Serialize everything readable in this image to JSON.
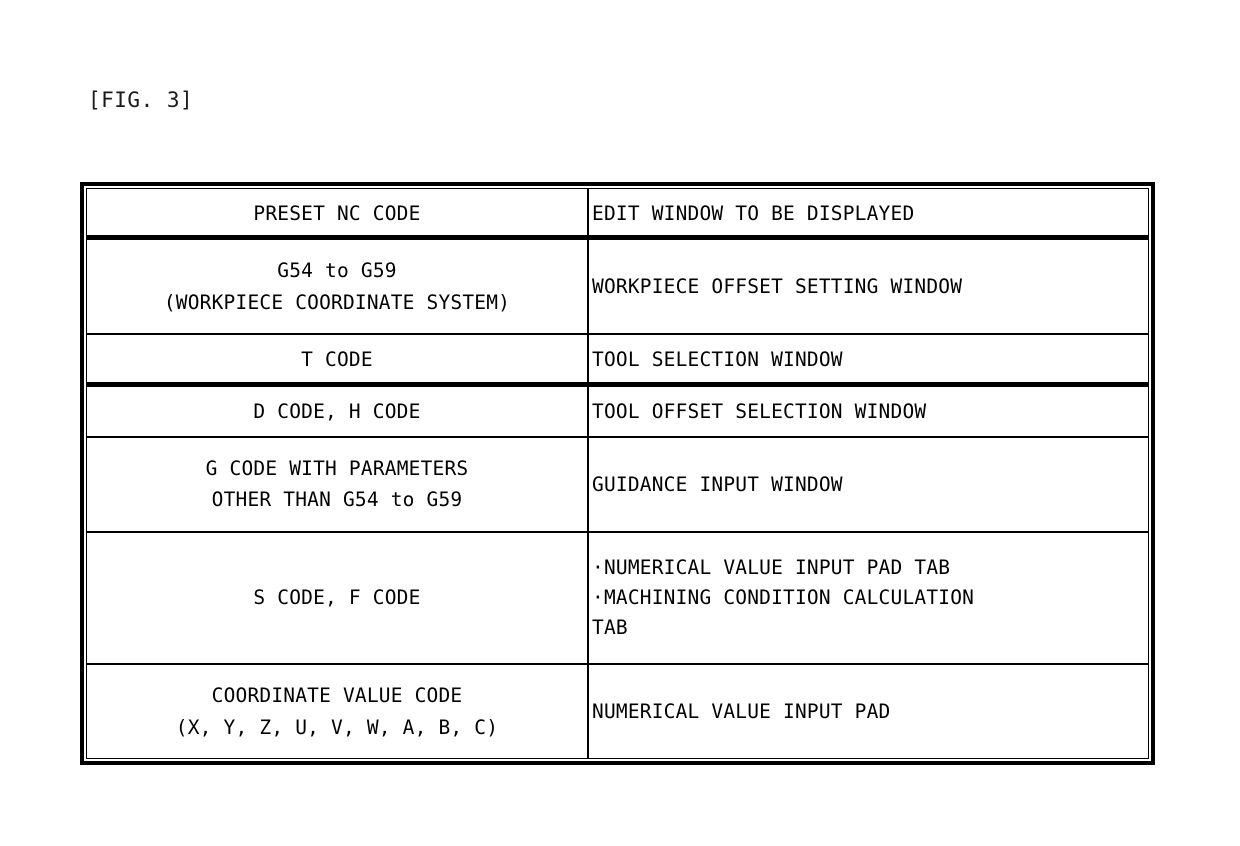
{
  "figure": {
    "label": "[FIG. 3]"
  },
  "table": {
    "headers": {
      "left": "PRESET NC CODE",
      "right": "EDIT WINDOW TO BE DISPLAYED"
    },
    "rows": [
      {
        "code": "G54 to G59\n(WORKPIECE COORDINATE SYSTEM)",
        "window": "WORKPIECE OFFSET SETTING WINDOW"
      },
      {
        "code": "T CODE",
        "window": "TOOL SELECTION WINDOW"
      },
      {
        "code": "D CODE, H CODE",
        "window": "TOOL OFFSET SELECTION WINDOW"
      },
      {
        "code": "G CODE WITH PARAMETERS\nOTHER THAN G54 to G59",
        "window": "GUIDANCE INPUT WINDOW"
      },
      {
        "code": "S CODE, F CODE",
        "window": "·NUMERICAL VALUE INPUT PAD TAB\n·MACHINING CONDITION CALCULATION\nTAB"
      },
      {
        "code": "COORDINATE VALUE CODE\n(X, Y, Z, U, V, W, A, B, C)",
        "window": "NUMERICAL VALUE INPUT PAD"
      }
    ]
  }
}
